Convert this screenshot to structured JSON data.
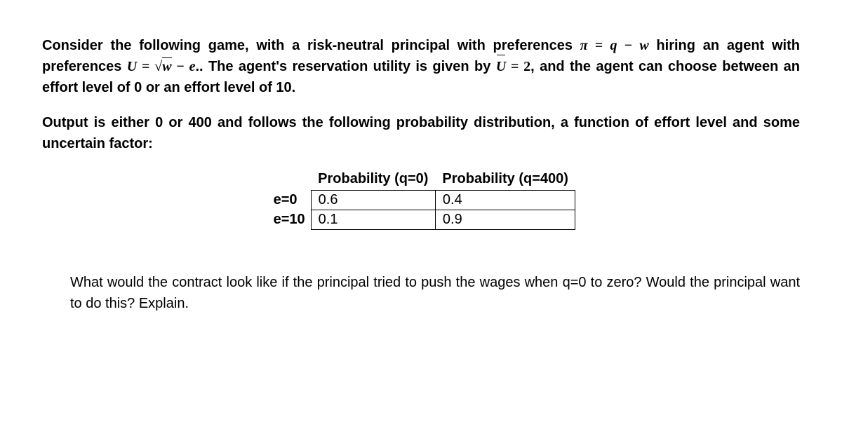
{
  "para1": {
    "t1": "Consider the following game, with a risk-neutral principal with preferences ",
    "eq1_pi": "π",
    "eq1_eq": " = ",
    "eq1_rhs_q": "q",
    "eq1_minus": " − ",
    "eq1_rhs_w": "w",
    "t2": " hiring an agent with preferences ",
    "eq2_U": "U",
    "eq2_eq": " = ",
    "eq2_sqrt_sym": "√",
    "eq2_sqrt_arg": "w",
    "eq2_minus": " − ",
    "eq2_e": "e",
    "eq2_dot": "..",
    "t3": " The agent's reservation utility is given by ",
    "eq3_Ubar": "U",
    "eq3_eq": " = ",
    "eq3_val": "2",
    "t4": ", and the agent can choose between an effort level of 0 or an effort level of 10."
  },
  "para2": "Output is either 0 or 400 and follows the following probability distribution, a function of effort level and some uncertain factor:",
  "table": {
    "headers": [
      "",
      "Probability (q=0)",
      "Probability (q=400)"
    ],
    "rows": [
      {
        "label": "e=0",
        "c1": "0.6",
        "c2": "0.4"
      },
      {
        "label": "e=10",
        "c1": "0.1",
        "c2": "0.9"
      }
    ]
  },
  "question": "What would the contract look like if the principal tried to push the wages when q=0 to zero? Would the principal want to do this? Explain."
}
